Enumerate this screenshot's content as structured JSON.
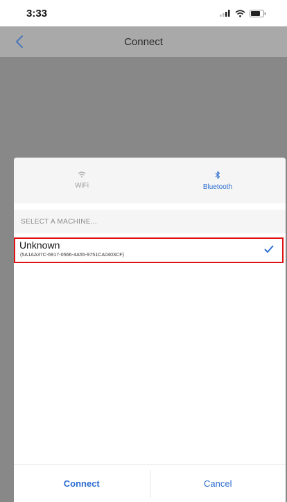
{
  "status_bar": {
    "time": "3:33"
  },
  "nav": {
    "title": "Connect"
  },
  "tabs": [
    {
      "label": "WiFi",
      "icon": "wifi-icon"
    },
    {
      "label": "Bluetooth",
      "icon": "bluetooth-icon"
    }
  ],
  "section": {
    "header": "SELECT A MACHINE..."
  },
  "machines": [
    {
      "name": "Unknown",
      "id": "(5A1AA37C-6917-0566-4A55-9751CA0403CF)",
      "selected": true
    }
  ],
  "actions": {
    "connect": "Connect",
    "cancel": "Cancel"
  },
  "colors": {
    "accent": "#2d6ed0",
    "highlight": "#e01010",
    "overlay": "#888888",
    "nav_background": "#a9a9a9"
  }
}
